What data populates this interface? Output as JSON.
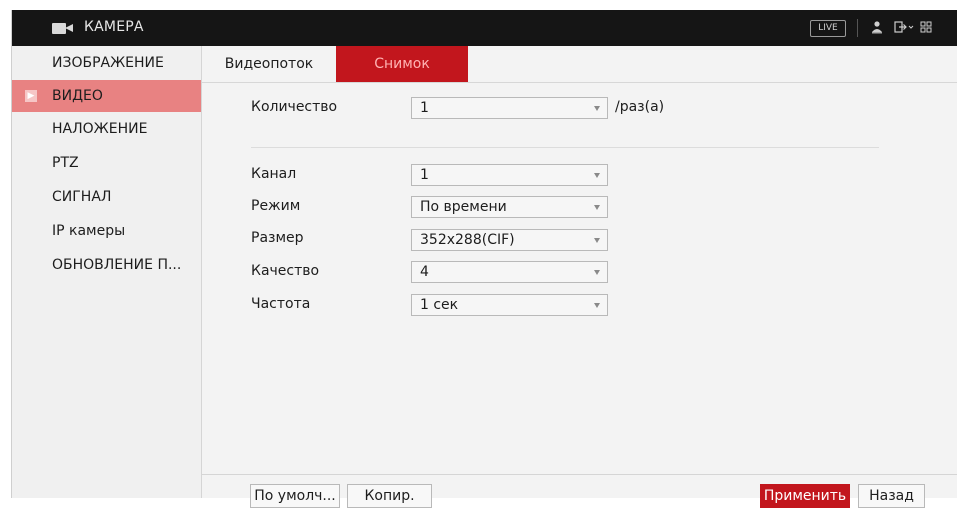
{
  "titlebar": {
    "title": "КАМЕРА",
    "live_label": "LIVE",
    "icons": [
      "camera-icon",
      "user-icon",
      "logout-icon",
      "grid-icon"
    ]
  },
  "sidebar": {
    "items": [
      {
        "label": "ИЗОБРАЖЕНИЕ",
        "active": false
      },
      {
        "label": "ВИДЕО",
        "active": true
      },
      {
        "label": "НАЛОЖЕНИЕ",
        "active": false
      },
      {
        "label": "PTZ",
        "active": false
      },
      {
        "label": "СИГНАЛ",
        "active": false
      },
      {
        "label": "IP камеры",
        "active": false
      },
      {
        "label": "ОБНОВЛЕНИЕ П...",
        "active": false
      }
    ]
  },
  "tabs": [
    {
      "label": "Видеопоток",
      "active": false
    },
    {
      "label": "Снимок",
      "active": true
    }
  ],
  "form": {
    "quantity": {
      "label": "Количество",
      "value": "1",
      "unit": "/раз(а)"
    },
    "channel": {
      "label": "Канал",
      "value": "1"
    },
    "mode": {
      "label": "Режим",
      "value": "По времени"
    },
    "size": {
      "label": "Размер",
      "value": "352x288(CIF)"
    },
    "quality": {
      "label": "Качество",
      "value": "4"
    },
    "frequency": {
      "label": "Частота",
      "value": "1 сек"
    }
  },
  "buttons": {
    "default": "По умолч...",
    "copy": "Копир.",
    "apply": "Применить",
    "back": "Назад"
  },
  "colors": {
    "accent": "#c2161d",
    "active_sidebar": "#e88282",
    "titlebar": "#151515"
  }
}
